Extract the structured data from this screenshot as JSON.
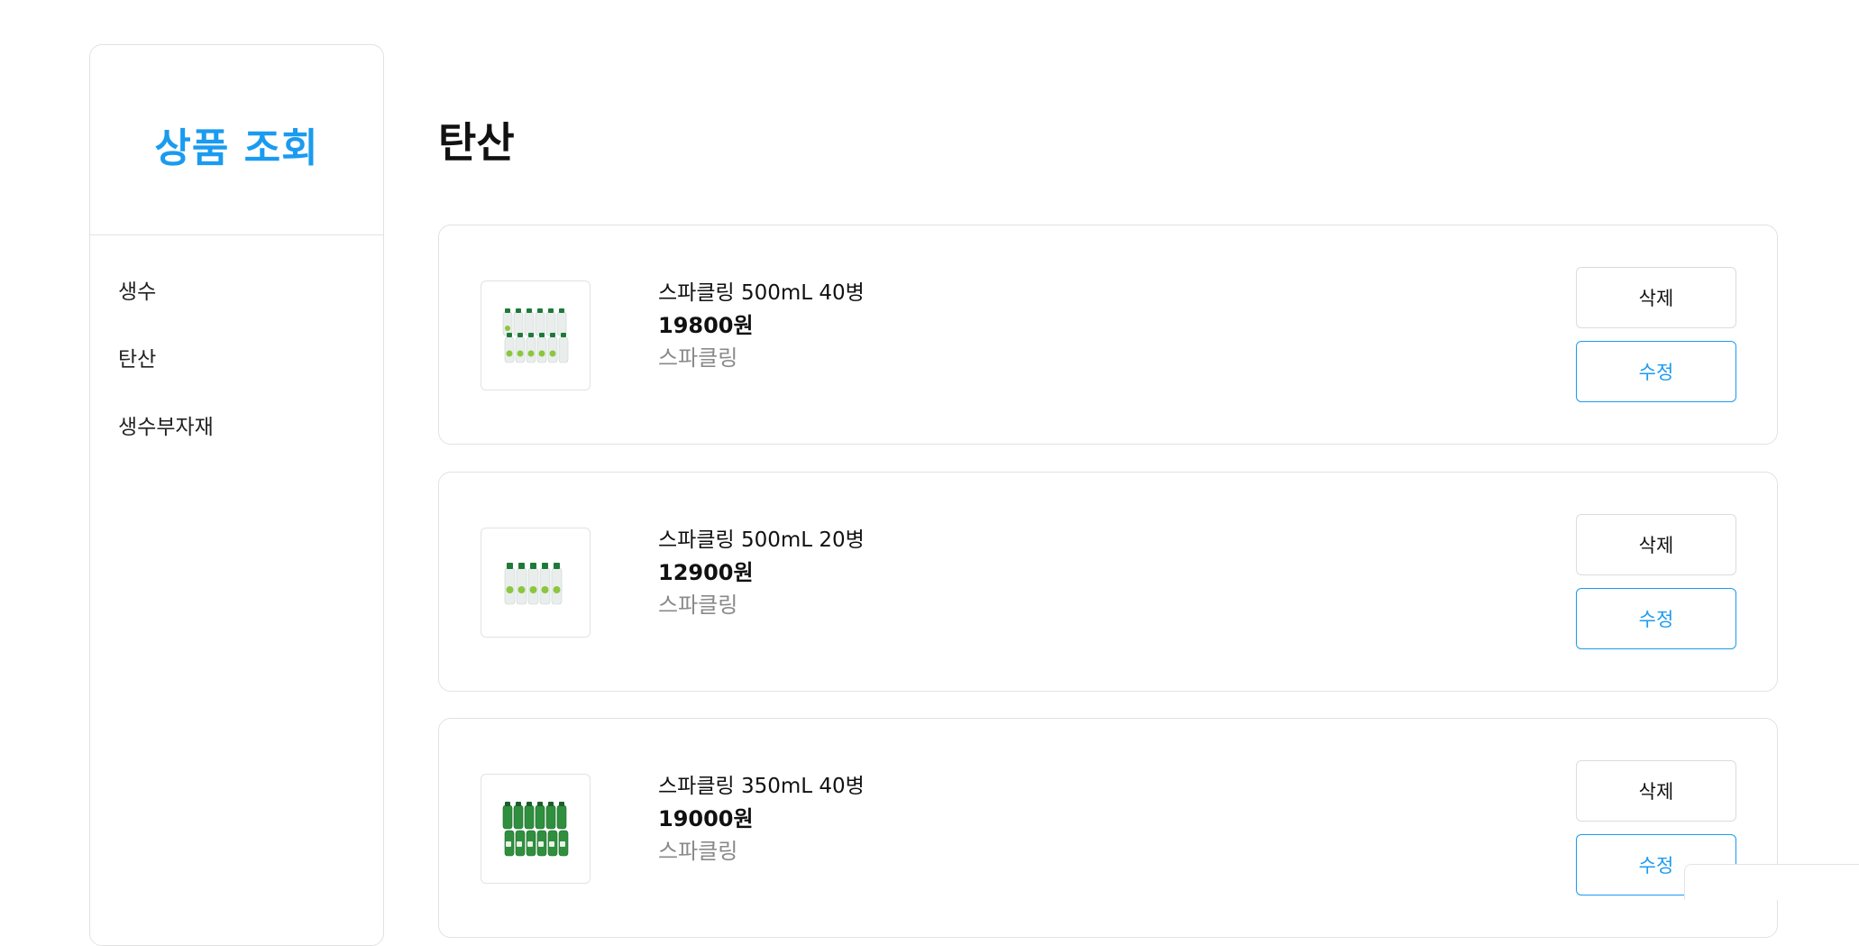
{
  "sidebar": {
    "title": "상품 조회",
    "items": [
      {
        "label": "생수"
      },
      {
        "label": "탄산"
      },
      {
        "label": "생수부자재"
      }
    ]
  },
  "main": {
    "title": "탄산",
    "products": [
      {
        "name": "스파클링 500mL 40병",
        "price": "19800원",
        "category": "스파클링",
        "image_icon": "bottle-pack-40-icon",
        "delete_label": "삭제",
        "edit_label": "수정"
      },
      {
        "name": "스파클링 500mL 20병",
        "price": "12900원",
        "category": "스파클링",
        "image_icon": "bottle-pack-20-icon",
        "delete_label": "삭제",
        "edit_label": "수정"
      },
      {
        "name": "스파클링 350mL 40병",
        "price": "19000원",
        "category": "스파클링",
        "image_icon": "green-bottle-pack-40-icon",
        "delete_label": "삭제",
        "edit_label": "수정"
      }
    ]
  },
  "colors": {
    "accent": "#1a9bf0",
    "border": "#e2e2e2",
    "muted_text": "#8a8a8a"
  }
}
